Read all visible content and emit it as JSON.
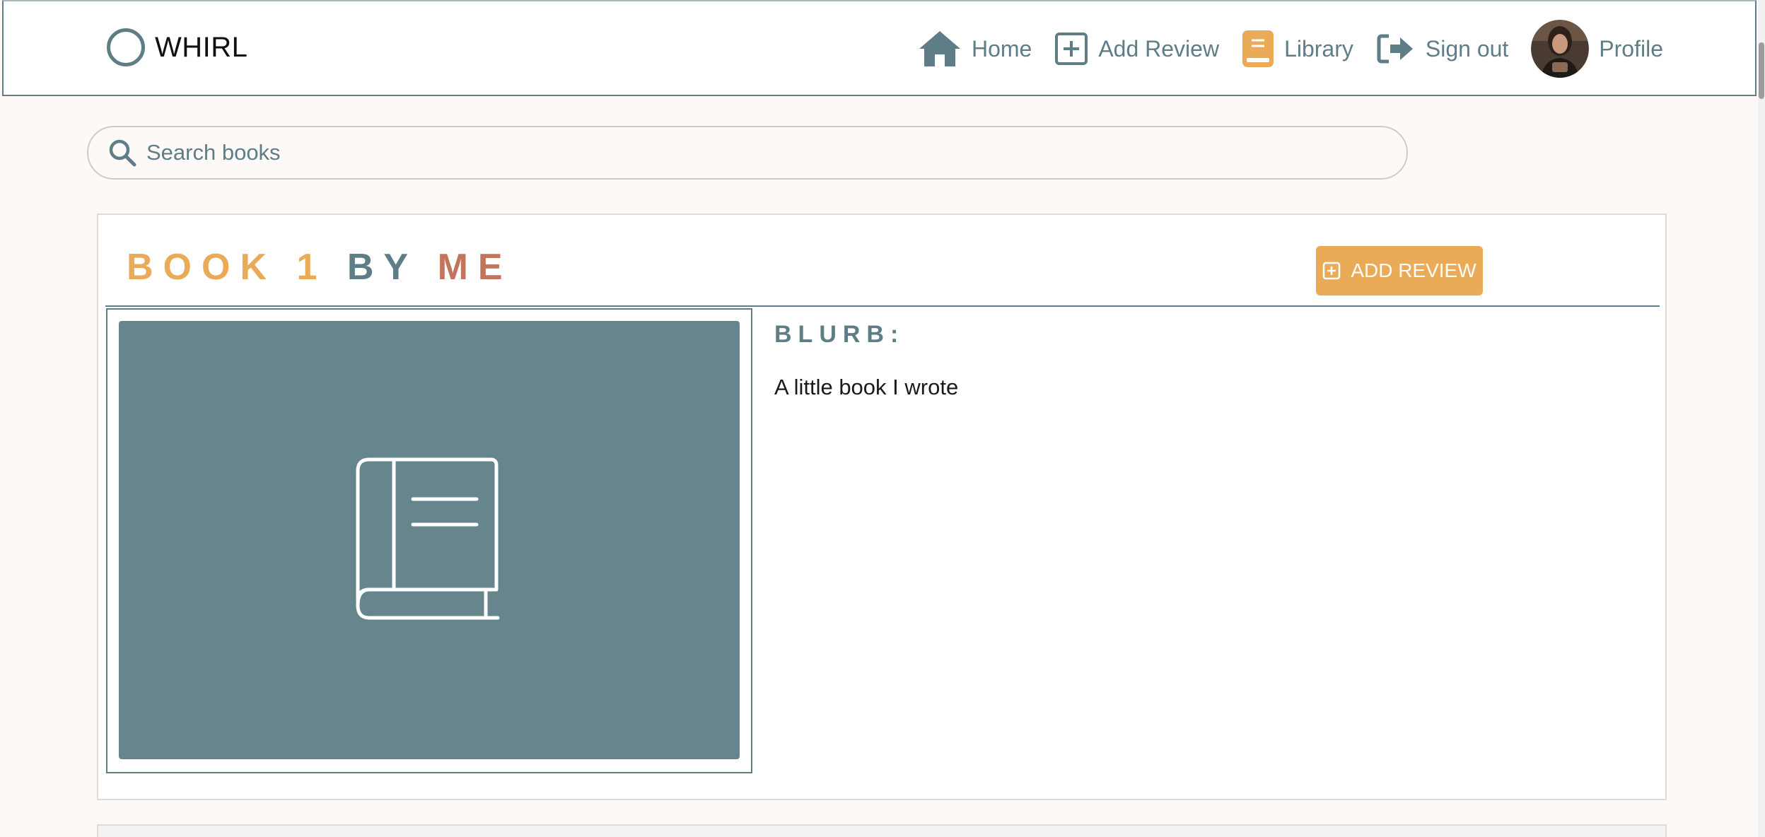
{
  "brand": {
    "name": "WHIRL"
  },
  "nav": {
    "home": "Home",
    "add_review": "Add Review",
    "library": "Library",
    "sign_out": "Sign out",
    "profile": "Profile"
  },
  "search": {
    "placeholder": "Search books"
  },
  "book": {
    "title": "BOOK 1",
    "by": "BY",
    "author": "ME",
    "add_review_label": "ADD REVIEW",
    "blurb_label": "BLURB:",
    "blurb": "A little book I wrote"
  },
  "colors": {
    "accent": "#5f7d87",
    "orange": "#e9ab58",
    "terracotta": "#c2755c",
    "cover": "#66858d",
    "background": "#fdf9f7"
  },
  "icons": {
    "brand": "circle-logo-icon",
    "home": "home-icon",
    "add_review": "plus-square-icon",
    "library": "book-icon",
    "sign_out": "sign-out-icon",
    "search": "search-icon",
    "cover": "book-outline-icon"
  }
}
